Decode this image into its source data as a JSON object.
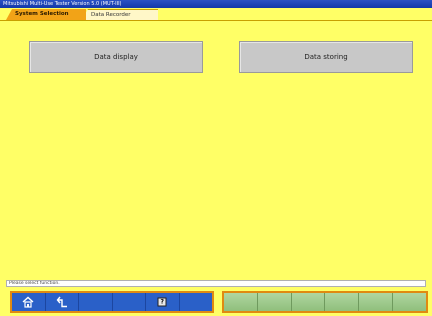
{
  "window": {
    "title": "Mitsubishi Multi-Use Tester Version 5.0 (MUT-III)"
  },
  "tabs": [
    {
      "label": "System Selection",
      "active": true
    },
    {
      "label": "Data Recorder",
      "active": false
    }
  ],
  "main": {
    "buttons": [
      {
        "label": "Data display"
      },
      {
        "label": "Data storing"
      }
    ]
  },
  "status": {
    "text": "Please select function."
  },
  "toolbar": {
    "left_icons": [
      "home-icon",
      "back-icon",
      "",
      "",
      "help-icon",
      ""
    ],
    "help_glyph": "?",
    "right_segments": 6
  },
  "colors": {
    "background": "#ffff66",
    "titlebar": "#1238a8",
    "tab_active": "#f2a317",
    "toolbar_blue": "#2a60c8",
    "toolbar_border": "#e08a10",
    "toolbar_green": "#8fbf7c"
  }
}
